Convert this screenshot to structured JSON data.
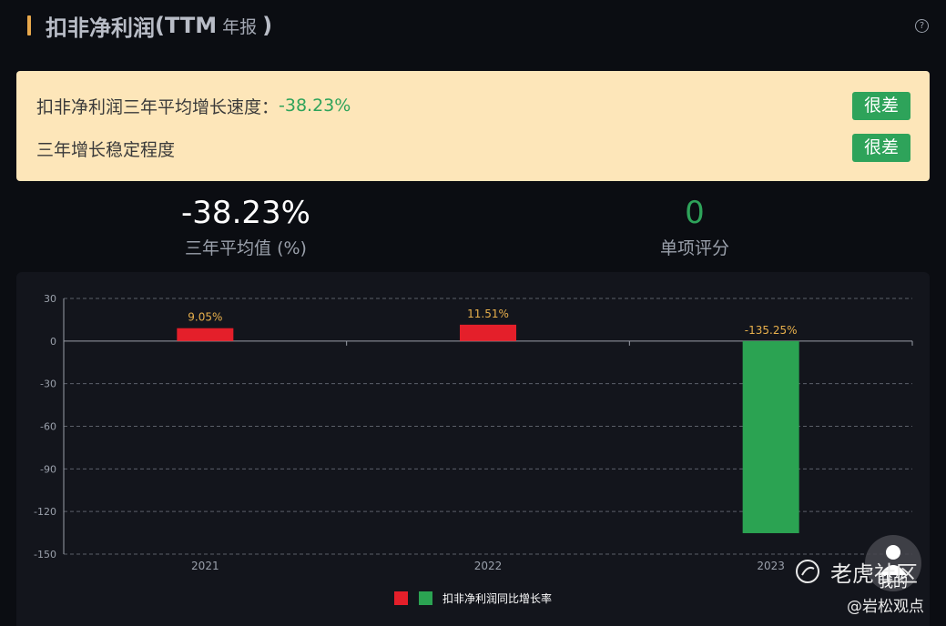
{
  "header": {
    "title": "扣非净利润",
    "title_open": "(TTM",
    "title_sub": "年报",
    "title_close": ")"
  },
  "summary": {
    "row1_label": "扣非净利润三年平均增长速度：",
    "row1_value": "-38.23%",
    "row1_rating": "很差",
    "row2_label": "三年增长稳定程度",
    "row2_rating": "很差"
  },
  "metrics": {
    "avg_value": "-38.23%",
    "avg_label": "三年平均值 (%)",
    "score_value": "0",
    "score_label": "单项评分"
  },
  "colors": {
    "positive": "#e41f2a",
    "negative": "#2ba352",
    "label": "#e8b04c",
    "score": "#2ea35a"
  },
  "chart_data": {
    "type": "bar",
    "categories": [
      "2021",
      "2022",
      "2023"
    ],
    "series": [
      {
        "name": "扣非净利润同比增长率",
        "values": [
          9.05,
          11.51,
          -135.25
        ]
      }
    ],
    "data_labels": [
      "9.05%",
      "11.51%",
      "-135.25%"
    ],
    "yticks": [
      30,
      0,
      -30,
      -60,
      -90,
      -120,
      -150
    ],
    "ylim": [
      -150,
      30
    ],
    "grid": true,
    "legend": "bottom-center"
  },
  "watermark": {
    "brand": "老虎社区",
    "author": "@岩松观点",
    "me_label": "我的"
  }
}
